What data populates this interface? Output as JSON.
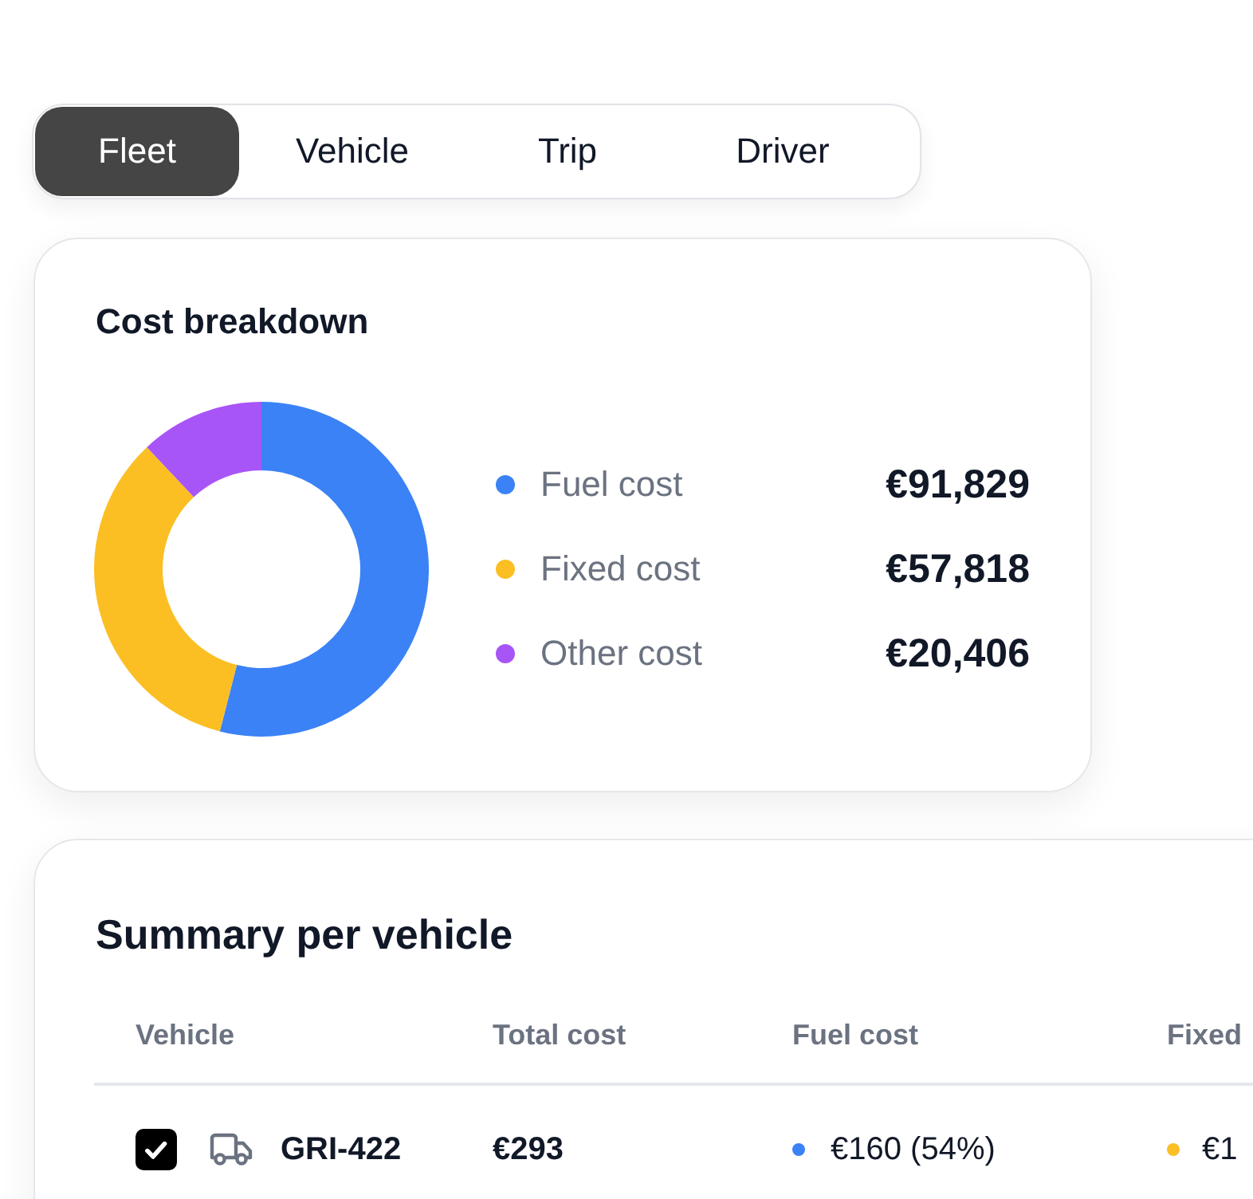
{
  "tabs": [
    {
      "label": "Fleet",
      "selected": true
    },
    {
      "label": "Vehicle",
      "selected": false
    },
    {
      "label": "Trip",
      "selected": false
    },
    {
      "label": "Driver",
      "selected": false
    }
  ],
  "cost_breakdown": {
    "title": "Cost breakdown",
    "chart_data": {
      "type": "donut",
      "categories": [
        "Fuel cost",
        "Fixed cost",
        "Other cost"
      ],
      "values": [
        54,
        34,
        12
      ]
    },
    "legend": [
      {
        "value": "€91,829",
        "color": "#3b82f6"
      },
      {
        "value": "€57,818",
        "color": "#fbbf24"
      },
      {
        "value": "€20,406",
        "color": "#a855f7"
      }
    ]
  },
  "summary": {
    "title": "Summary per vehicle",
    "columns": [
      "Vehicle",
      "Total cost",
      "Fuel cost",
      "Fixed"
    ],
    "rows": [
      {
        "checked": true,
        "vehicle": "GRI-422",
        "total_cost": "€293",
        "fuel_cost": {
          "text": "€160 (54%)",
          "color": "#3b82f6"
        },
        "column_4": {
          "text": "€1",
          "color": "#fbbf24"
        }
      }
    ]
  }
}
